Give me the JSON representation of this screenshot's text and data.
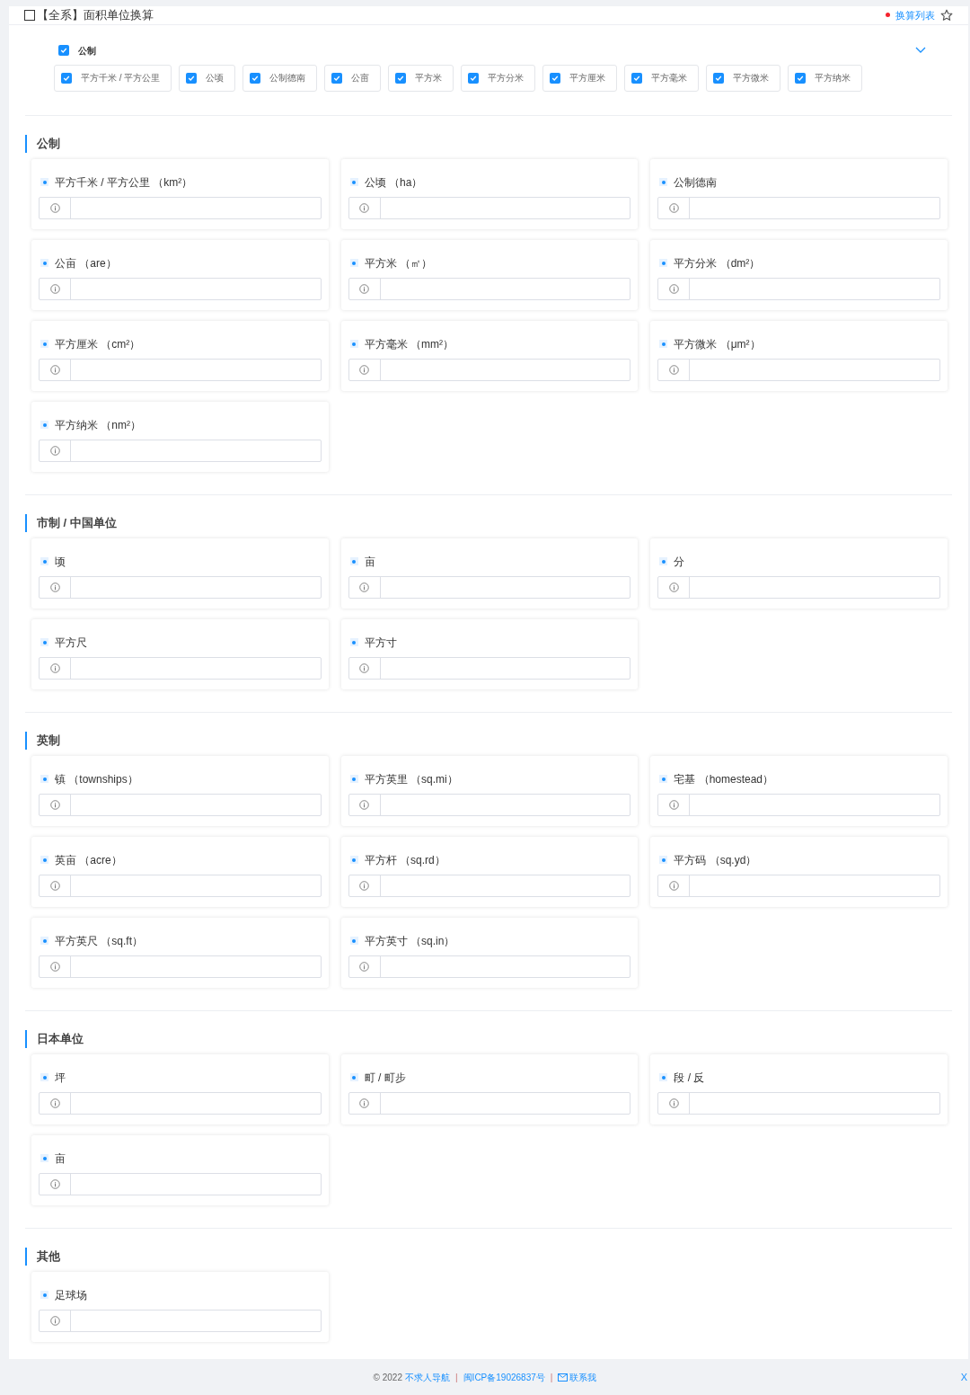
{
  "header": {
    "title": "【全系】面积单位换算",
    "checked": false,
    "list_link": "换算列表",
    "starred": false
  },
  "filter": {
    "group": {
      "label": "公制",
      "checked": true
    },
    "expanded": false,
    "options": [
      {
        "label": "平方千米 / 平方公里",
        "checked": true
      },
      {
        "label": "公顷",
        "checked": true
      },
      {
        "label": "公制德南",
        "checked": true
      },
      {
        "label": "公亩",
        "checked": true
      },
      {
        "label": "平方米",
        "checked": true
      },
      {
        "label": "平方分米",
        "checked": true
      },
      {
        "label": "平方厘米",
        "checked": true
      },
      {
        "label": "平方毫米",
        "checked": true
      },
      {
        "label": "平方微米",
        "checked": true
      },
      {
        "label": "平方纳米",
        "checked": true
      }
    ]
  },
  "sections": [
    {
      "title": "公制",
      "units": [
        "平方千米 / 平方公里 （km²）",
        "公顷 （ha）",
        "公制德南",
        "公亩 （are）",
        "平方米 （㎡）",
        "平方分米 （dm²）",
        "平方厘米 （cm²）",
        "平方毫米 （mm²）",
        "平方微米 （μm²）",
        "平方纳米 （nm²）"
      ]
    },
    {
      "title": "市制 / 中国单位",
      "units": [
        "顷",
        "亩",
        "分",
        "平方尺",
        "平方寸"
      ]
    },
    {
      "title": "英制",
      "units": [
        "镇 （townships）",
        "平方英里 （sq.mi）",
        "宅基 （homestead）",
        "英亩 （acre）",
        "平方杆 （sq.rd）",
        "平方码 （sq.yd）",
        "平方英尺 （sq.ft）",
        "平方英寸 （sq.in）"
      ]
    },
    {
      "title": "日本单位",
      "units": [
        "坪",
        "町 / 町步",
        "段 / 反",
        "亩"
      ]
    },
    {
      "title": "其他",
      "units": [
        "足球场"
      ]
    }
  ],
  "footer": {
    "copyright": "© 2022",
    "site_link": "不求人导航",
    "separator_1": "|",
    "icp_link": "闽ICP备19026837号",
    "separator_2": "|",
    "contact_link": "联系我",
    "close": "X"
  }
}
